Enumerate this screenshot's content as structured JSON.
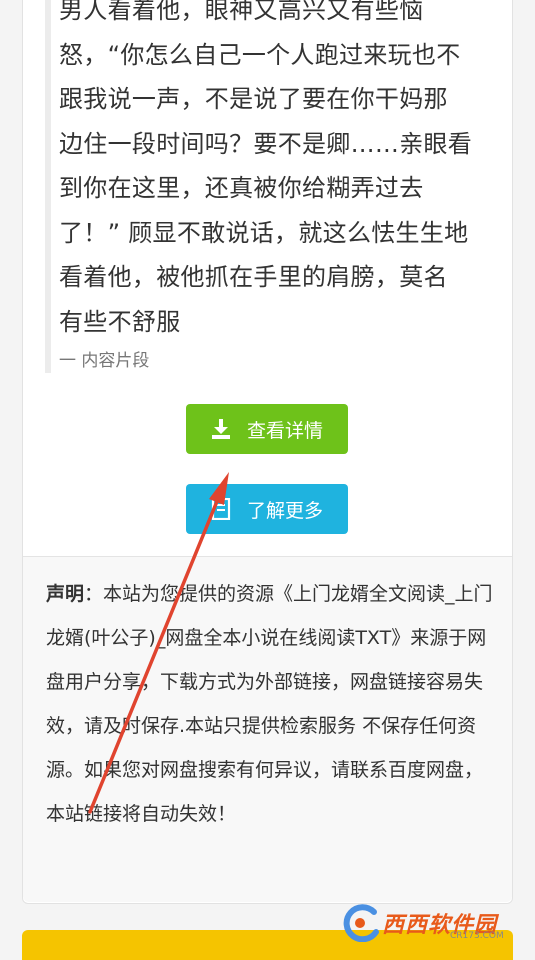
{
  "excerpt": {
    "lines": [
      "男人看着他，眼神又高兴又有些恼",
      "怒，“你怎么自己一个人跑过来玩也不",
      "跟我说一声，不是说了要在你干妈那",
      "边住一段时间吗？要不是卿……亲眼看",
      "到你在这里，还真被你给糊弄过去",
      "了！” 顾显不敢说话，就这么怯生生地",
      "看着他，被他抓在手里的肩膀，莫名",
      "有些不舒服"
    ],
    "source": "一 内容片段"
  },
  "buttons": {
    "detail_label": "查看详情",
    "more_label": "了解更多",
    "detail_color": "#6ec21a",
    "more_color": "#1fb3df"
  },
  "notice": {
    "label": "声明",
    "text": "：本站为您提供的资源《上门龙婿全文阅读_上门龙婿(叶公子)_网盘全本小说在线阅读TXT》来源于网盘用户分享，下载方式为外部链接，网盘链接容易失效，请及时保存.本站只提供检索服务 不保存任何资源。如果您对网盘搜索有何异议，请联系百度网盘，本站链接将自动失效！"
  },
  "watermark": {
    "title": "西西软件园",
    "url": "CR173.COM"
  }
}
